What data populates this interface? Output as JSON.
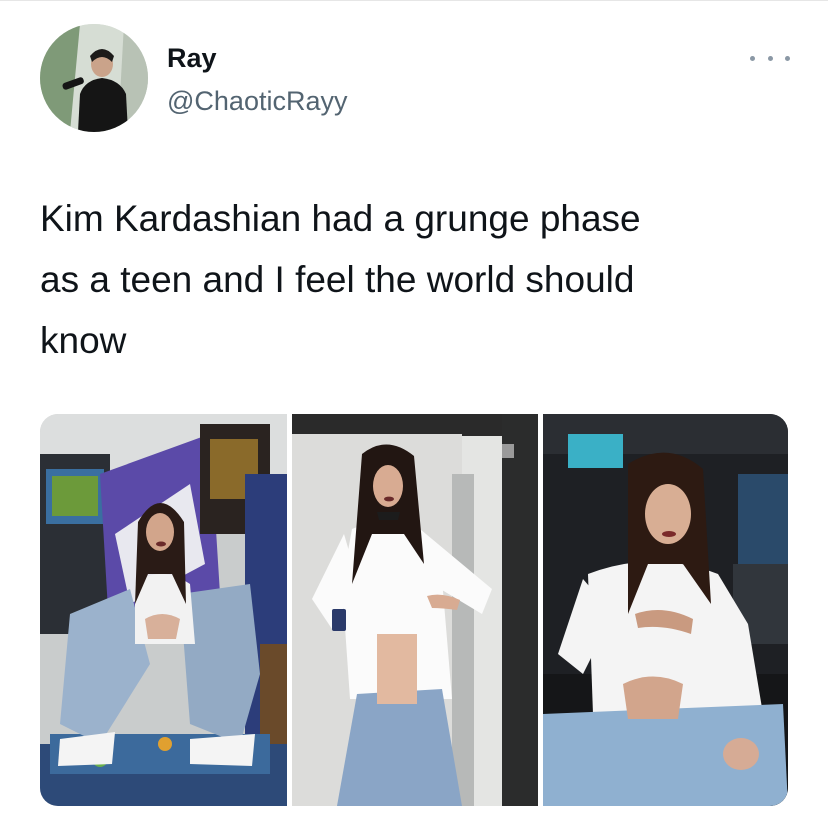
{
  "tweet": {
    "display_name": "Ray",
    "handle": "@ChaoticRayy",
    "text": "Kim Kardashian had a grunge phase\nas a teen and I feel the world should\nknow",
    "more_icon": "more-horizontal-icon"
  },
  "media": {
    "photo_count": 3,
    "photos": [
      {
        "subject": "girl crouching on arcade cabinet controls"
      },
      {
        "subject": "girl standing, holding a pager"
      },
      {
        "subject": "girl seated in front of arcade screens"
      }
    ]
  },
  "colors": {
    "text": "#0f1419",
    "secondary": "#536471",
    "more_icon": "#8b98a5",
    "background": "#ffffff"
  }
}
